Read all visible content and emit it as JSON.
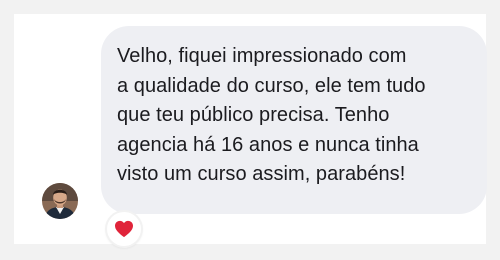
{
  "message": {
    "text": "Velho, fiquei  impressionado  com\na qualidade  do  curso, ele tem tudo\nque teu público  precisa. Tenho\nagencia há 16 anos e  nunca tinha\nvisto um curso assim, parabéns!"
  },
  "reaction": {
    "icon": "heart-icon",
    "color": "#e0243a"
  },
  "colors": {
    "bubble": "#eeeff3",
    "panel": "#ffffff",
    "background": "#f2f2f2",
    "text": "#1b1b1f"
  }
}
